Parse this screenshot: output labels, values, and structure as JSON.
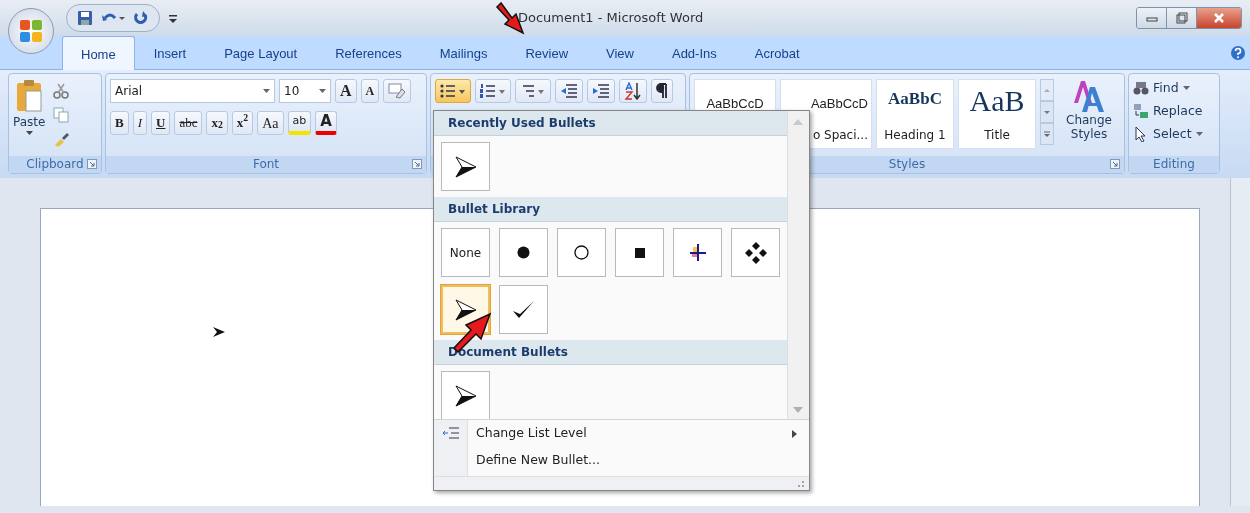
{
  "window": {
    "title": "Document1 - Microsoft Word"
  },
  "tabs": [
    {
      "label": "Home",
      "selected": true
    },
    {
      "label": "Insert",
      "selected": false
    },
    {
      "label": "Page Layout",
      "selected": false
    },
    {
      "label": "References",
      "selected": false
    },
    {
      "label": "Mailings",
      "selected": false
    },
    {
      "label": "Review",
      "selected": false
    },
    {
      "label": "View",
      "selected": false
    },
    {
      "label": "Add-Ins",
      "selected": false
    },
    {
      "label": "Acrobat",
      "selected": false
    }
  ],
  "clipboard": {
    "paste_label": "Paste",
    "group_label": "Clipboard"
  },
  "font": {
    "name": "Arial",
    "size": "10",
    "grow_label": "A",
    "shrink_label": "A",
    "highlight_label": "ab",
    "color_label": "A",
    "group_label": "Font",
    "format_buttons": [
      {
        "label": "B",
        "kind": "bold"
      },
      {
        "label": "I",
        "kind": "italic"
      },
      {
        "label": "U",
        "kind": "underline"
      },
      {
        "label": "abc",
        "kind": "strike"
      },
      {
        "label": "x$_{2}$",
        "kind": "plain"
      },
      {
        "label": "x$^{2}$",
        "kind": "plain"
      },
      {
        "label": "Aa",
        "kind": "case"
      }
    ]
  },
  "styles": {
    "items": [
      {
        "sample": "AaBbCcD",
        "kind": "normal"
      },
      {
        "sample": "AaBbCcD",
        "label": "o Spaci...",
        "kind": "normal"
      },
      {
        "sample": "AaBbC",
        "label": "Heading 1",
        "kind": "heading"
      },
      {
        "sample": "AaB",
        "label": "Title",
        "kind": "title"
      }
    ],
    "change_label": "Change Styles",
    "group_label": "Styles"
  },
  "editing": {
    "items": [
      {
        "label": "Find",
        "kind": "find"
      },
      {
        "label": "Replace",
        "kind": "replace"
      },
      {
        "label": "Select",
        "kind": "select"
      }
    ],
    "group_label": "Editing"
  },
  "bullets_menu": {
    "sections": [
      {
        "title": "Recently Used Bullets",
        "items": [
          {
            "kind": "arrowhead",
            "selected": false
          }
        ]
      },
      {
        "title": "Bullet Library",
        "items": [
          {
            "kind": "none",
            "label": "None",
            "selected": false
          },
          {
            "kind": "dot",
            "selected": false
          },
          {
            "kind": "circle",
            "selected": false
          },
          {
            "kind": "square",
            "selected": false
          },
          {
            "kind": "cross",
            "selected": false
          },
          {
            "kind": "diamonds",
            "selected": false
          },
          {
            "kind": "arrowhead",
            "selected": true
          },
          {
            "kind": "check",
            "selected": false
          }
        ]
      },
      {
        "title": "Document Bullets",
        "items": [
          {
            "kind": "arrowhead",
            "selected": false
          }
        ]
      }
    ],
    "commands": [
      {
        "label": "Change List Level",
        "submenu": true
      },
      {
        "label": "Define New Bullet...",
        "submenu": false
      }
    ]
  }
}
